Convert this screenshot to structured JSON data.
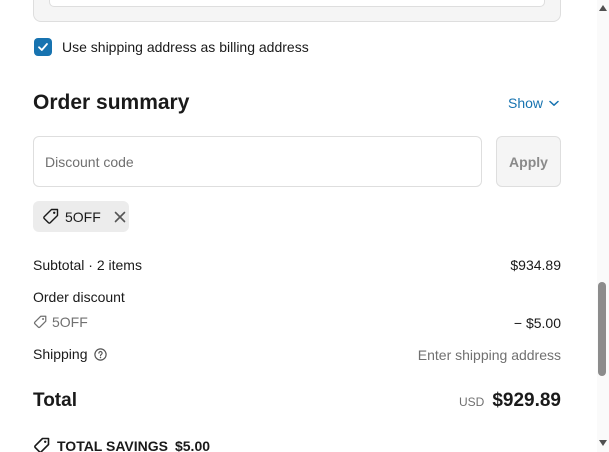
{
  "billing": {
    "checkbox_checked": true,
    "label": "Use shipping address as billing address"
  },
  "order_summary": {
    "title": "Order summary",
    "toggle_label": "Show"
  },
  "discount": {
    "placeholder": "Discount code",
    "apply_label": "Apply",
    "applied_code": "5OFF"
  },
  "lines": {
    "subtotal_label": "Subtotal · 2 items",
    "subtotal_value": "$934.89",
    "order_discount_label": "Order discount",
    "order_discount_code": "5OFF",
    "order_discount_value": "− $5.00",
    "shipping_label": "Shipping",
    "shipping_value": "Enter shipping address"
  },
  "total": {
    "label": "Total",
    "currency": "USD",
    "amount": "$929.89"
  },
  "savings": {
    "label": "TOTAL SAVINGS",
    "amount": "$5.00"
  },
  "colors": {
    "accent": "#1773b0",
    "muted": "#707070",
    "border": "#dedede"
  }
}
